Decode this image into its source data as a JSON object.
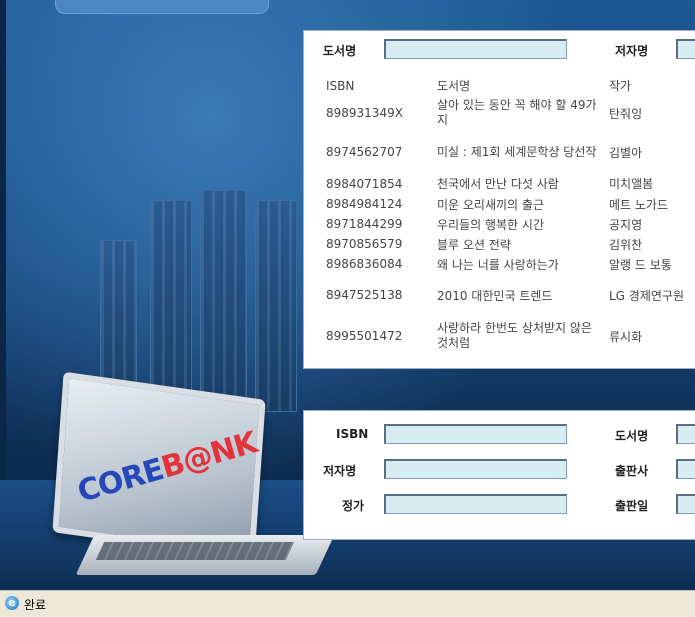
{
  "search_panel": {
    "title_label": "도서명",
    "author_label": "저자명",
    "columns": [
      "ISBN",
      "도서명",
      "작가"
    ],
    "rows": [
      {
        "isbn": "898931349X",
        "title": "살아 있는 동안 꼭 해야 할 49가지",
        "author": "탄줘잉"
      },
      {
        "isbn": "8974562707",
        "title": "미실 : 제1회 세계문학상 당선작",
        "author": "김별아"
      },
      {
        "isbn": "8984071854",
        "title": "천국에서 만난 다섯 사람",
        "author": "미치앨봄"
      },
      {
        "isbn": "8984984124",
        "title": "미운 오리새끼의 출근",
        "author": "메트 노가드"
      },
      {
        "isbn": "8971844299",
        "title": "우리들의 행복한 시간",
        "author": "공지영"
      },
      {
        "isbn": "8970856579",
        "title": "블루 오션 전략",
        "author": "김위찬"
      },
      {
        "isbn": "8986836084",
        "title": "왜 나는 너를 사랑하는가",
        "author": "알랭 드 보통"
      },
      {
        "isbn": "8947525138",
        "title": "2010 대한민국 트렌드",
        "author": "LG 경제연구원"
      },
      {
        "isbn": "8995501472",
        "title": "사랑하라 한번도 상처받지 않은 것처럼",
        "author": "류시화"
      }
    ]
  },
  "detail_panel": {
    "isbn_label": "ISBN",
    "title_label": "도서명",
    "author_label": "저자명",
    "publisher_label": "출판사",
    "price_label": "정가",
    "pubdate_label": "출판일"
  },
  "background": {
    "logo_text_a": "CORE",
    "logo_text_b": "B@NK"
  },
  "status_bar": {
    "icon": "ie-page-icon",
    "text": "완료"
  },
  "colors": {
    "input_fill": "#d7edf2",
    "status_bar": "#ece9d8",
    "logo_blue": "#2746b8",
    "logo_red": "#e2323a"
  }
}
